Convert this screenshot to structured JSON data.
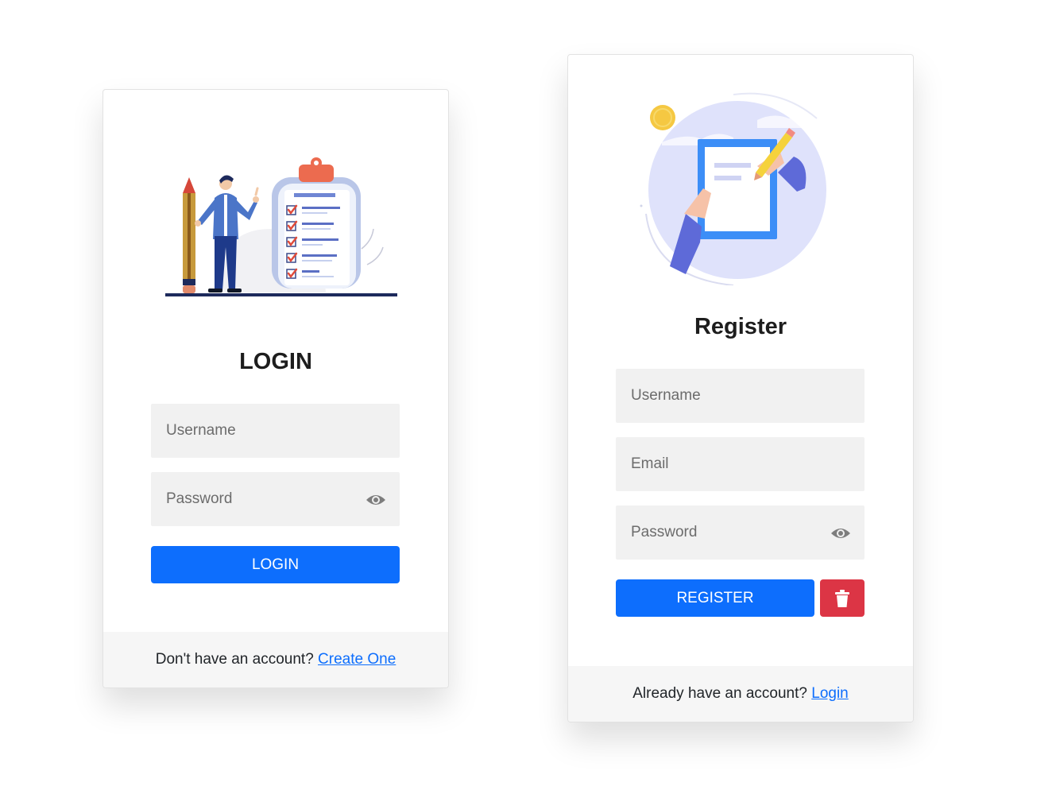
{
  "login": {
    "title": "LOGIN",
    "username_placeholder": "Username",
    "password_placeholder": "Password",
    "button_label": "LOGIN",
    "footer_text": "Don't have an account? ",
    "footer_link": "Create One"
  },
  "register": {
    "title": "Register",
    "username_placeholder": "Username",
    "email_placeholder": "Email",
    "password_placeholder": "Password",
    "button_label": "REGISTER",
    "clear_icon": "trash-icon",
    "footer_text": "Already have an account? ",
    "footer_link": "Login"
  },
  "colors": {
    "primary": "#0d6efd",
    "danger": "#dc3545",
    "field_bg": "#f1f1f1",
    "footer_bg": "#f6f6f6"
  },
  "icons": {
    "password_toggle": "eye-icon"
  }
}
